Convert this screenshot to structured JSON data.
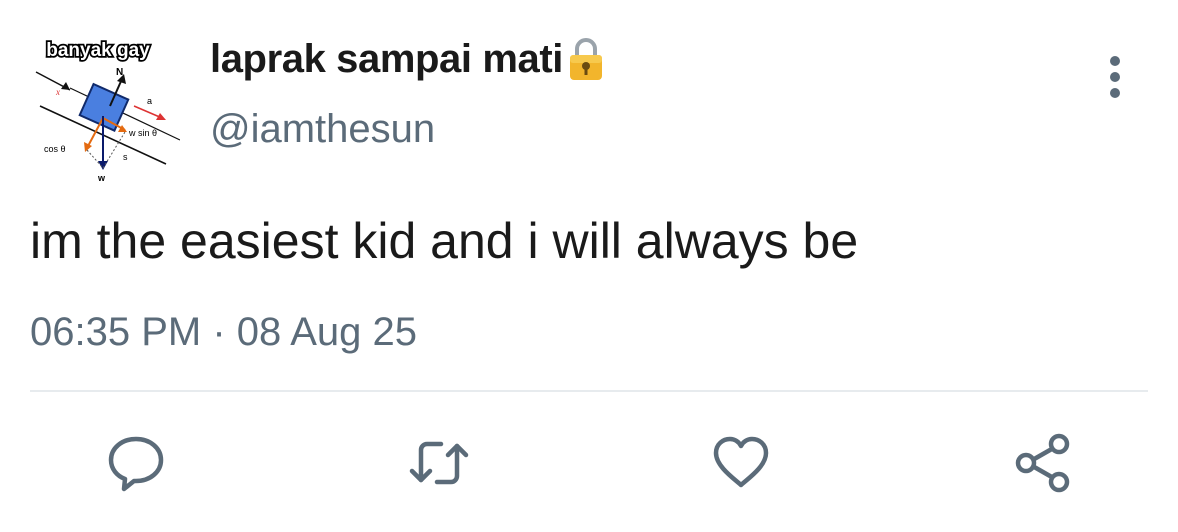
{
  "user": {
    "display_name": "laprak sampai mati",
    "handle": "@iamthesun",
    "avatar_caption": "banyak gay"
  },
  "tweet": {
    "text": "im the easiest kid and i will always be",
    "time": "06:35 PM",
    "separator": "·",
    "date": "08 Aug 25"
  },
  "actions": [
    {
      "name": "reply",
      "icon": "speech-bubble-icon"
    },
    {
      "name": "retweet",
      "icon": "retweet-arrows-icon"
    },
    {
      "name": "like",
      "icon": "heart-icon"
    },
    {
      "name": "share",
      "icon": "share-nodes-icon"
    }
  ],
  "colors": {
    "text_primary": "#1a1a1a",
    "text_secondary": "#5b6b79",
    "divider": "#e7ebee",
    "lock_gold": "#f2b52c"
  },
  "avatar_diagram_labels": {
    "normal": "N",
    "accel": "a",
    "x_axis": "x",
    "w_sin": "w sin θ",
    "w_cos": "cos θ",
    "weight": "w",
    "s": "s"
  }
}
